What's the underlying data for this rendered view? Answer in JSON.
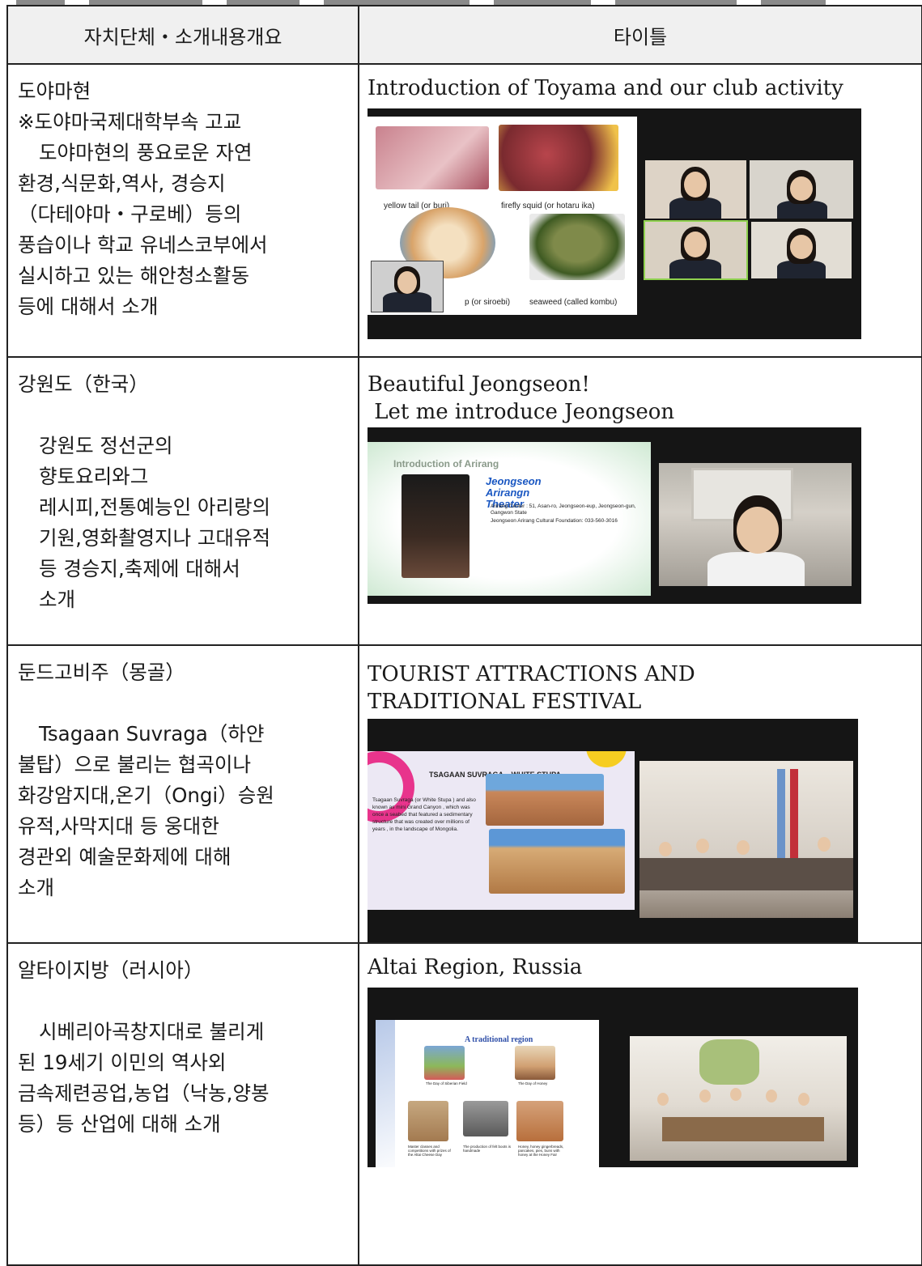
{
  "table": {
    "headers": [
      "자치단체・소개내용개요",
      "타이틀"
    ],
    "rows": [
      {
        "region": "도야마현",
        "school": "※도야마국제대학부속 고교",
        "description_lines": [
          "도야마현의 풍요로운 자연",
          "환경,식문화,역사, 경승지",
          "（다테야마・구로베）등의",
          "풍습이나 학교 유네스코부에서",
          "실시하고 있는 해안청소활동",
          "등에 대해서 소개"
        ],
        "title_lines": [
          "Introduction of Toyama and our club activity"
        ],
        "slide_captions": [
          "yellow tail (or buri)",
          "firefly squid (or hotaru ika)",
          "p (or siroebi)",
          "seaweed (called kombu)"
        ]
      },
      {
        "region": "강원도（한국）",
        "description_lines": [
          "강원도 정선군의",
          "향토요리와그",
          "레시피,전통예능인 아리랑의",
          "기원,영화촬영지나 고대유적",
          "등 경승지,축제에 대해서",
          "소개"
        ],
        "title_lines": [
          "Beautiful Jeongseon!",
          " Let me introduce Jeongseon"
        ],
        "slide_header": "Introduction of Arirang",
        "slide_heading": "Jeongseon Arirangn Theater",
        "slide_bullets": [
          "Arirang Center : 51, Asan-ro, Jeongseon-eup, Jeongseon-gun, Gangwon State",
          "Jeongseon Arirang Cultural Foundation: 033-560-3016"
        ]
      },
      {
        "region": "둔드고비주（몽골）",
        "description_lines": [
          "Tsagaan Suvraga（하얀",
          "불탑）으로 불리는 협곡이나",
          "화강암지대,온기（Ongi）승원",
          "유적,사막지대 등 웅대한",
          "경관외 예술문화제에 대해",
          "소개"
        ],
        "title_lines": [
          "TOURIST ATTRACTIONS AND",
          "TRADITIONAL FESTIVAL"
        ],
        "slide_heading": "TSAGAAN SUVRAGA – WHITE STUPA",
        "slide_body": "Tsagaan Suvraga (or White Stupa ) and also known as mini Grand Canyon , which was once a seabed that featured a sedimentary structure that was created over millions of years , in the landscape of Mongolia."
      },
      {
        "region": "알타이지방（러시아）",
        "description_lines": [
          "시베리아곡창지대로 불리게",
          "된 19세기 이민의 역사외",
          "금속제련공업,농업（낙농,양봉",
          "등）등 산업에 대해 소개"
        ],
        "title_lines": [
          "Altai Region, Russia"
        ],
        "slide_heading": "A traditional region",
        "slide_captions": [
          "The Day of Siberian Field",
          "The Day of Honey",
          "Master classes and competitions with prizes of the Altai Cheese Day",
          "The production of felt boots is handmade",
          "Honey, honey gingerbreads, pancakes, pies, buns with honey at the Honey Fair"
        ]
      }
    ]
  }
}
